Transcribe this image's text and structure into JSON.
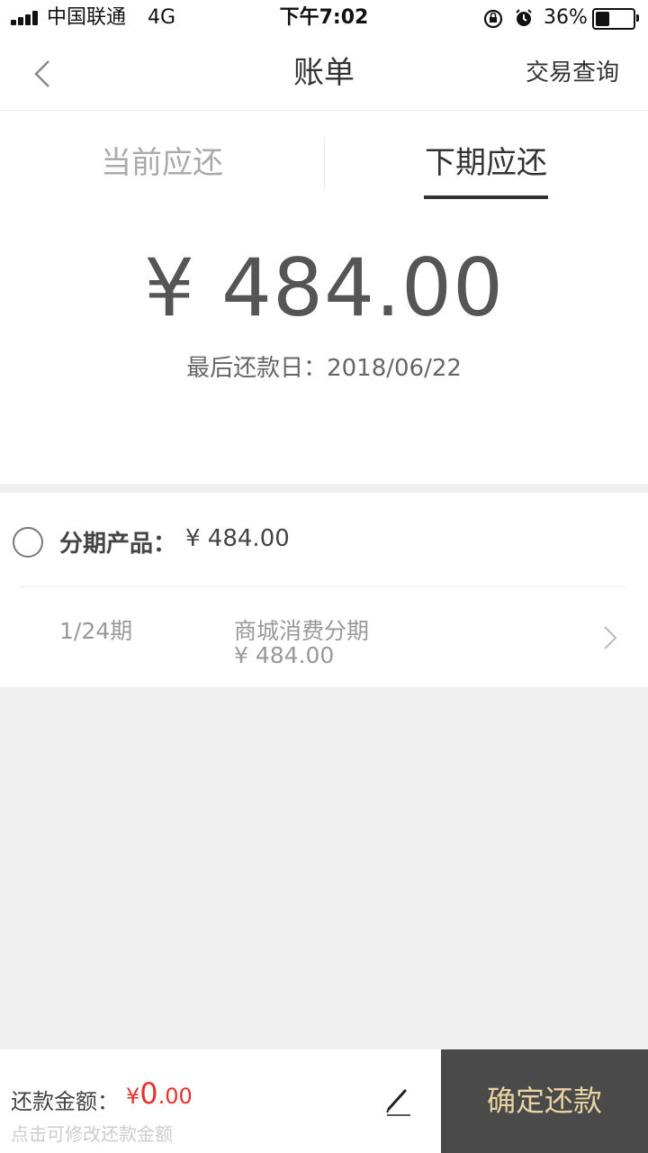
{
  "status_bar": {
    "carrier": "中国联通",
    "network": "4G",
    "time": "下午7:02",
    "battery_percent": "36%"
  },
  "nav": {
    "title": "账单",
    "right_action": "交易查询"
  },
  "tabs": [
    {
      "label": "当前应还",
      "active": false
    },
    {
      "label": "下期应还",
      "active": true
    }
  ],
  "summary": {
    "amount": "¥ 484.00",
    "due_label": "最后还款日：",
    "due_date": "2018/06/22"
  },
  "product": {
    "label": "分期产品：",
    "total": "¥ 484.00",
    "period": "1/24期",
    "plan_name": "商城消费分期",
    "plan_amount": "¥ 484.00"
  },
  "footer": {
    "pay_label": "还款金额：",
    "pay_currency": "¥",
    "pay_int": "0",
    "pay_dec": ".00",
    "hint": "点击可修改还款金额",
    "confirm": "确定还款"
  },
  "colors": {
    "accent_red": "#e5322d",
    "button_bg": "#4a4a4a",
    "button_text": "#e8d3a2"
  }
}
